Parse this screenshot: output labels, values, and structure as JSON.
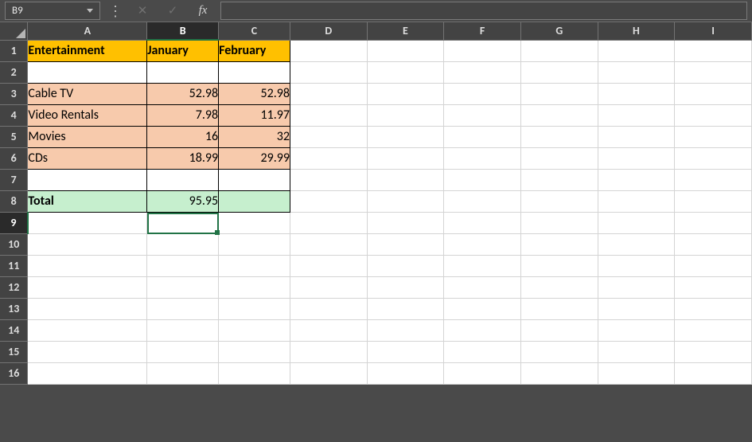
{
  "namebox": {
    "value": "B9"
  },
  "formula_bar": {
    "cancel_icon": "✕",
    "confirm_icon": "✓",
    "fx_label": "fx",
    "value": ""
  },
  "columns": [
    "A",
    "B",
    "C",
    "D",
    "E",
    "F",
    "G",
    "H",
    "I"
  ],
  "rows": [
    "1",
    "2",
    "3",
    "4",
    "5",
    "6",
    "7",
    "8",
    "9",
    "10",
    "11",
    "12",
    "13",
    "14",
    "15",
    "16"
  ],
  "active_cell": {
    "row": 9,
    "col": "B"
  },
  "cells": {
    "A1": "Entertainment",
    "B1": "January",
    "C1": "February",
    "A3": "Cable TV",
    "B3": "52.98",
    "C3": "52.98",
    "A4": "Video Rentals",
    "B4": "7.98",
    "C4": "11.97",
    "A5": "Movies",
    "B5": "16",
    "C5": "32",
    "A6": "CDs",
    "B6": "18.99",
    "C6": "29.99",
    "A8": "Total",
    "B8": "95.95"
  },
  "chart_data": {
    "type": "table",
    "title": "Entertainment",
    "categories": [
      "January",
      "February"
    ],
    "series": [
      {
        "name": "Cable TV",
        "values": [
          52.98,
          52.98
        ]
      },
      {
        "name": "Video Rentals",
        "values": [
          7.98,
          11.97
        ]
      },
      {
        "name": "Movies",
        "values": [
          16,
          32
        ]
      },
      {
        "name": "CDs",
        "values": [
          18.99,
          29.99
        ]
      }
    ],
    "totals": {
      "January": 95.95
    }
  }
}
